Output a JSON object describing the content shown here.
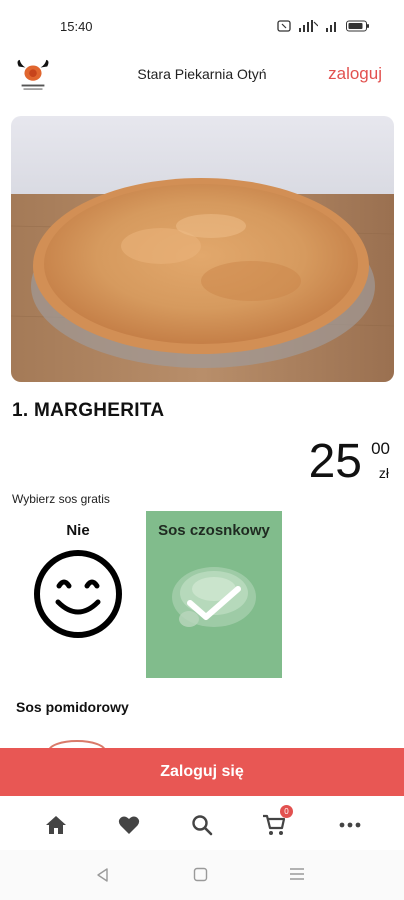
{
  "status_bar": {
    "time": "15:40"
  },
  "header": {
    "logo_icon": "bull-logo-icon",
    "title": "Stara Piekarnia Otyń",
    "login_link": "zaloguj"
  },
  "product": {
    "name": "1. MARGHERITA",
    "price_main": "25",
    "price_cents": "00",
    "currency": "zł"
  },
  "sauce": {
    "prompt": "Wybierz sos gratis",
    "options": [
      {
        "label": "Nie",
        "icon": "smiley-icon",
        "selected": false
      },
      {
        "label": "Sos czosnkowy",
        "icon": "check-icon",
        "selected": true
      }
    ],
    "next_label": "Sos pomidorowy"
  },
  "login_button": "Zaloguj się",
  "bottom_nav": {
    "items": [
      "home-icon",
      "heart-icon",
      "search-icon",
      "cart-icon",
      "more-icon"
    ],
    "cart_count": "0"
  },
  "colors": {
    "accent": "#e85754",
    "selected_card": "#81bc8c"
  }
}
